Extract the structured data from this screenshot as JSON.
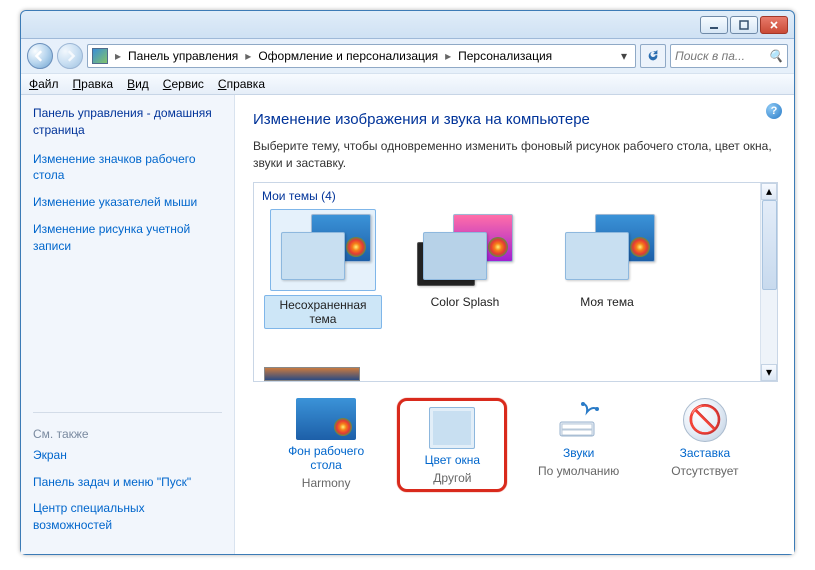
{
  "breadcrumb": {
    "seg1": "Панель управления",
    "seg2": "Оформление и персонализация",
    "seg3": "Персонализация"
  },
  "search": {
    "placeholder": "Поиск в па..."
  },
  "menu": {
    "file": "Файл",
    "edit": "Правка",
    "view": "Вид",
    "tools": "Сервис",
    "help": "Справка"
  },
  "sidebar": {
    "home": "Панель управления - домашняя страница",
    "links": [
      "Изменение значков рабочего стола",
      "Изменение указателей мыши",
      "Изменение рисунка учетной записи"
    ],
    "also_hdr": "См. также",
    "also": [
      "Экран",
      "Панель задач и меню \"Пуск\"",
      "Центр специальных возможностей"
    ]
  },
  "main": {
    "title": "Изменение изображения и звука на компьютере",
    "subtitle": "Выберите тему, чтобы одновременно изменить фоновый рисунок рабочего стола, цвет окна, звуки и заставку.",
    "themes_hdr": "Мои темы (4)",
    "themes": [
      {
        "name": "Несохраненная тема"
      },
      {
        "name": "Color Splash"
      },
      {
        "name": "Моя тема"
      }
    ]
  },
  "options": {
    "desktop": {
      "label": "Фон рабочего стола",
      "value": "Harmony"
    },
    "color": {
      "label": "Цвет окна",
      "value": "Другой"
    },
    "sound": {
      "label": "Звуки",
      "value": "По умолчанию"
    },
    "saver": {
      "label": "Заставка",
      "value": "Отсутствует"
    }
  }
}
